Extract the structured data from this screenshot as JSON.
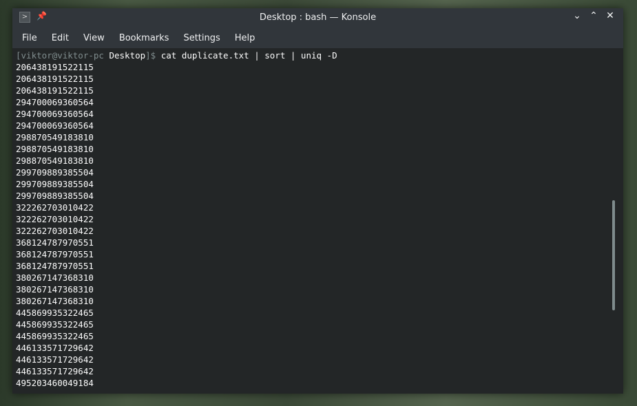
{
  "window": {
    "title": "Desktop : bash — Konsole"
  },
  "menu": [
    "File",
    "Edit",
    "View",
    "Bookmarks",
    "Settings",
    "Help"
  ],
  "terminal": {
    "prompt_user": "[viktor@viktor-pc ",
    "prompt_dir": "Desktop",
    "prompt_end": "]$ ",
    "command": "cat duplicate.txt | sort | uniq -D",
    "output": [
      "206438191522115",
      "206438191522115",
      "206438191522115",
      "294700069360564",
      "294700069360564",
      "294700069360564",
      "298870549183810",
      "298870549183810",
      "298870549183810",
      "299709889385504",
      "299709889385504",
      "299709889385504",
      "322262703010422",
      "322262703010422",
      "322262703010422",
      "368124787970551",
      "368124787970551",
      "368124787970551",
      "380267147368310",
      "380267147368310",
      "380267147368310",
      "445869935322465",
      "445869935322465",
      "445869935322465",
      "446133571729642",
      "446133571729642",
      "446133571729642",
      "495203460049184"
    ]
  }
}
